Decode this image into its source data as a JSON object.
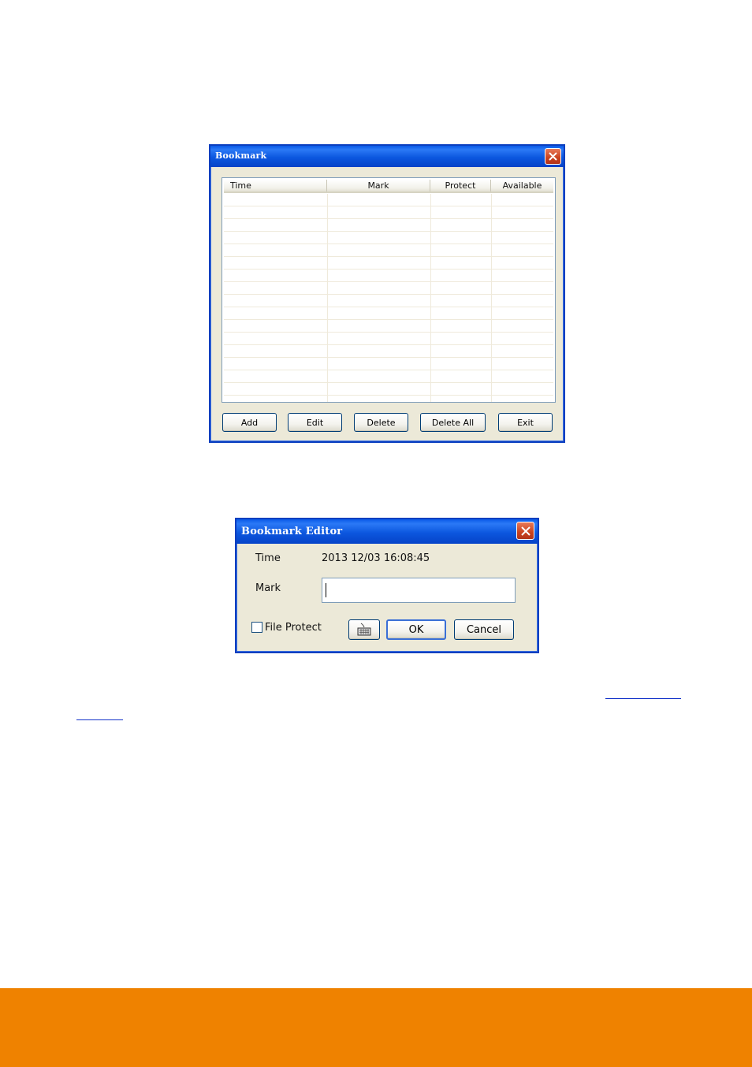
{
  "bookmark_window": {
    "title": "Bookmark",
    "columns": [
      "Time",
      "Mark",
      "Protect",
      "Available"
    ],
    "rows": [],
    "buttons": {
      "add": "Add",
      "edit": "Edit",
      "delete": "Delete",
      "delete_all": "Delete All",
      "exit": "Exit"
    }
  },
  "editor_window": {
    "title": "Bookmark Editor",
    "time_label": "Time",
    "time_value": "2013 12/03 16:08:45",
    "mark_label": "Mark",
    "mark_value": "",
    "file_protect_label": "File Protect",
    "file_protect_checked": false,
    "keyboard_icon": "keyboard-icon",
    "ok_label": "OK",
    "cancel_label": "Cancel"
  },
  "colors": {
    "titlebar": "#0a5ae8",
    "window_bg": "#ece9d8",
    "close_button": "#c9421e",
    "footer_bar": "#ef8200",
    "link": "#1030c8"
  }
}
